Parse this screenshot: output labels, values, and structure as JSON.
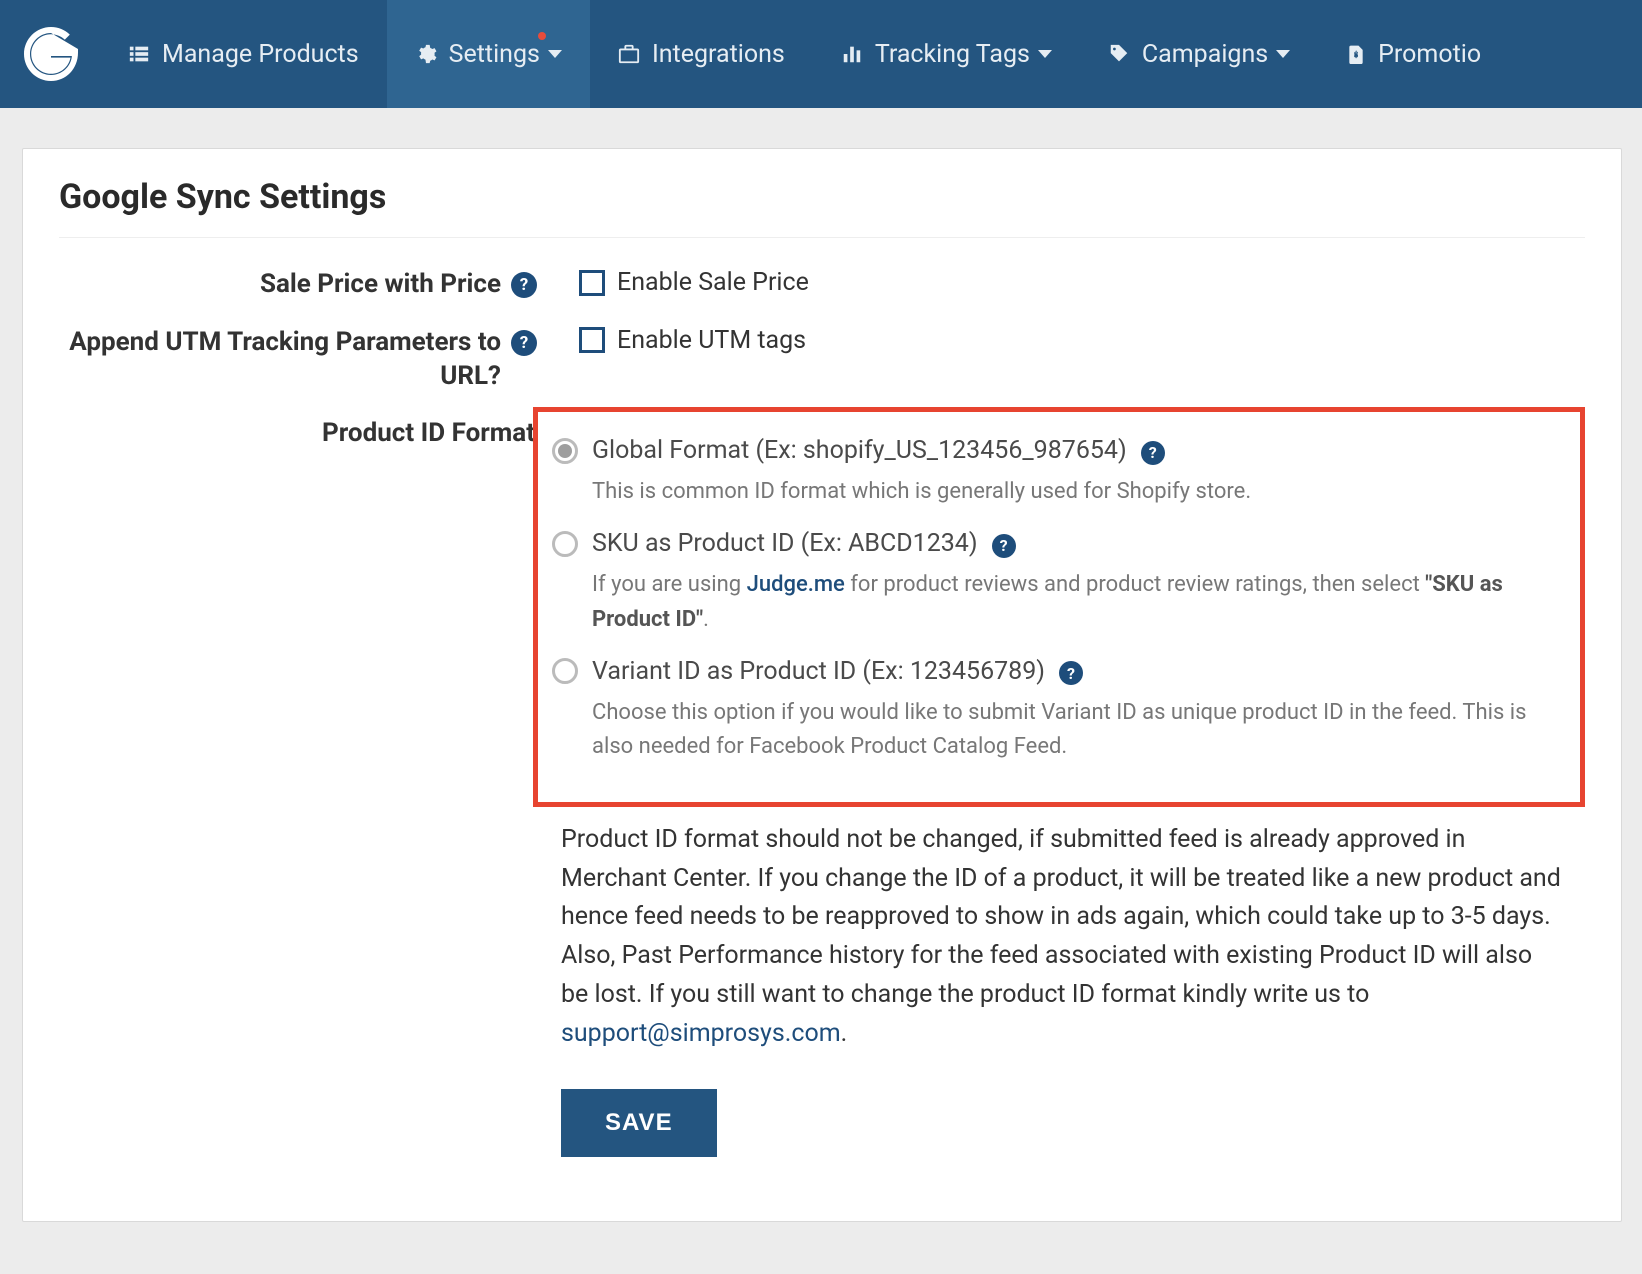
{
  "nav": {
    "items": [
      {
        "label": "Manage Products"
      },
      {
        "label": "Settings"
      },
      {
        "label": "Integrations"
      },
      {
        "label": "Tracking Tags"
      },
      {
        "label": "Campaigns"
      },
      {
        "label": "Promotio"
      }
    ]
  },
  "page": {
    "title": "Google Sync Settings"
  },
  "sale_price": {
    "label": "Sale Price with Price",
    "checkbox_label": "Enable Sale Price"
  },
  "utm": {
    "label": "Append UTM Tracking Parameters to URL?",
    "checkbox_label": "Enable UTM tags"
  },
  "product_id": {
    "label": "Product ID Format",
    "options": [
      {
        "label": "Global Format (Ex: shopify_US_123456_987654)",
        "desc": "This is common ID format which is generally used for Shopify store."
      },
      {
        "label": "SKU as Product ID (Ex: ABCD1234)",
        "desc_prefix": "If you are using ",
        "desc_link": "Judge.me",
        "desc_middle": " for product reviews and product review ratings, then select ",
        "desc_bold": "\"SKU as Product ID\"",
        "desc_suffix": "."
      },
      {
        "label": "Variant ID as Product ID (Ex: 123456789)",
        "desc": "Choose this option if you would like to submit Variant ID as unique product ID in the feed. This is also needed for Facebook Product Catalog Feed."
      }
    ],
    "note_prefix": "Product ID format should not be changed, if submitted feed is already approved in Merchant Center. If you change the ID of a product, it will be treated like a new product and hence feed needs to be reapproved to show in ads again, which could take up to 3-5 days. Also, Past Performance history for the feed associated with existing Product ID will also be lost. If you still want to change the product ID format kindly write us to ",
    "note_link": "support@simprosys.com",
    "note_suffix": "."
  },
  "save_button": "SAVE"
}
